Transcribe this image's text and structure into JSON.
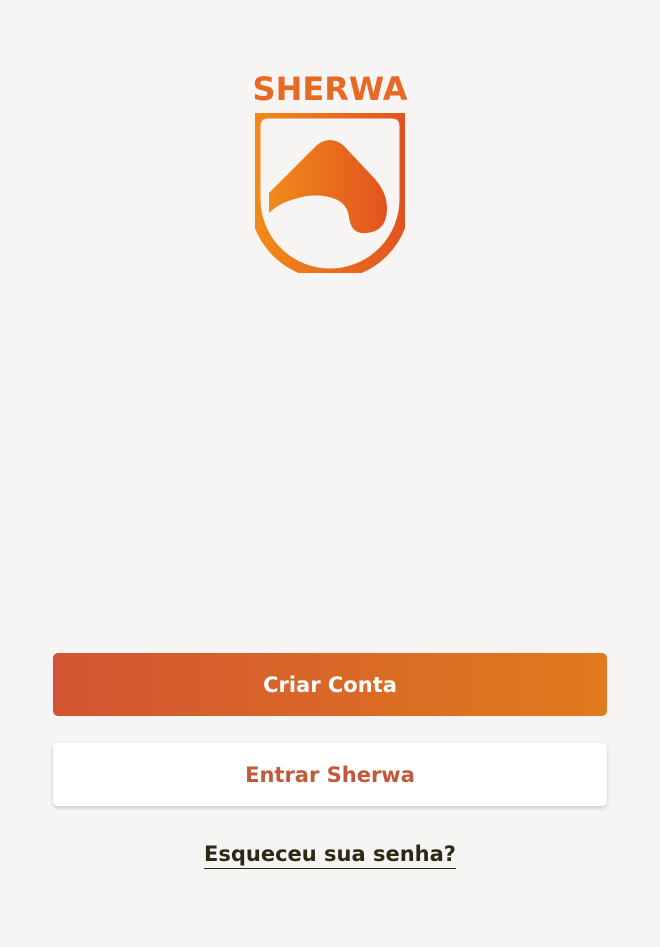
{
  "brand": {
    "name": "SHERWA",
    "primary_color": "#e66a24",
    "gradient_start": "#d35432",
    "gradient_end": "#e07b1c",
    "logo_icon": "mountain-shield-icon"
  },
  "actions": {
    "create_account_label": "Criar Conta",
    "login_label": "Entrar Sherwa",
    "forgot_password_label": "Esqueceu sua senha?"
  }
}
